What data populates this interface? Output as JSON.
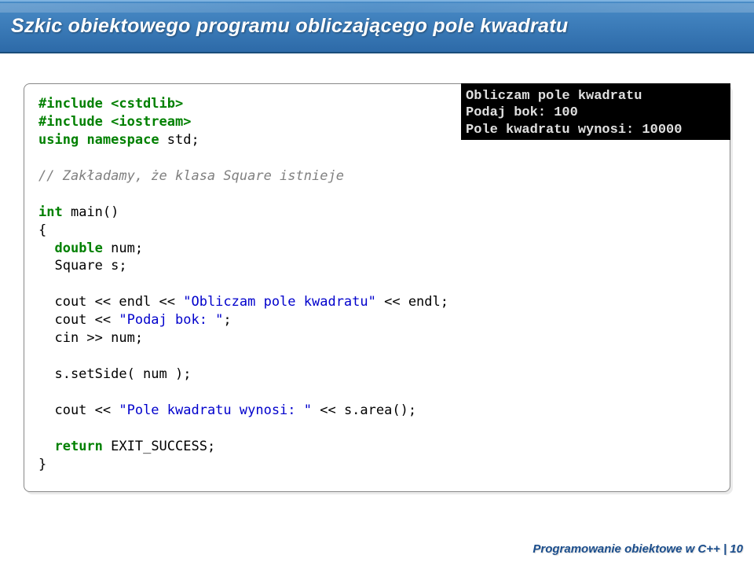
{
  "slide": {
    "title": "Szkic obiektowego programu obliczającego pole kwadratu"
  },
  "code": {
    "include1": "#include <cstdlib>",
    "include2": "#include <iostream>",
    "using_kw": "using",
    "namespace_kw": "namespace",
    "std_semi": " std;",
    "comment1": "// Zakładamy, że klasa Square istnieje",
    "int_kw": "int",
    "main_sig": " main()",
    "lbrace": "{",
    "double_kw": "double",
    "num_decl": " num;",
    "square_decl": "  Square s;",
    "cout1_a": "  cout << endl << ",
    "cout1_str": "\"Obliczam pole kwadratu\"",
    "cout1_b": " << endl;",
    "cout2_a": "  cout << ",
    "cout2_str": "\"Podaj bok: \"",
    "cout2_b": ";",
    "cin_line": "  cin >> num;",
    "setside": "  s.setSide( num );",
    "cout3_a": "  cout << ",
    "cout3_str": "\"Pole kwadratu wynosi: \"",
    "cout3_b": " << s.area();",
    "return_kw": "return",
    "return_tail": " EXIT_SUCCESS;",
    "rbrace": "}"
  },
  "terminal": {
    "line1": "Obliczam pole kwadratu",
    "line2": "Podaj bok: 100",
    "line3": "Pole kwadratu wynosi: 10000"
  },
  "footer": {
    "text": "Programowanie obiektowe w C++ | 10"
  }
}
